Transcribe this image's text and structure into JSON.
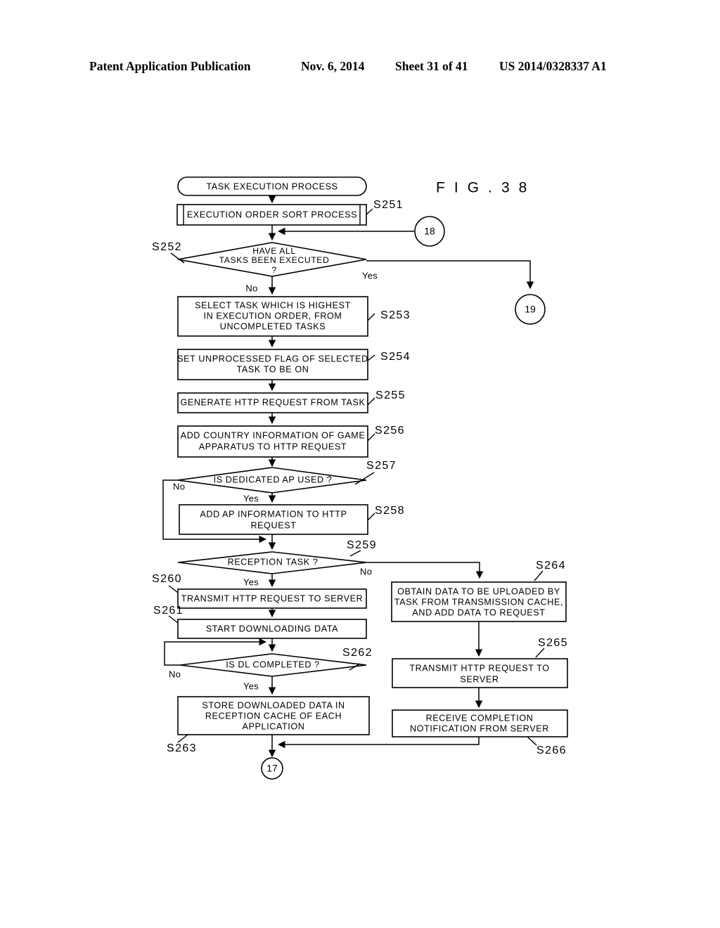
{
  "header": {
    "publication": "Patent Application Publication",
    "date": "Nov. 6, 2014",
    "sheet": "Sheet 31 of 41",
    "patent_number": "US 2014/0328337 A1"
  },
  "figure": {
    "title": "F I G .  3 8",
    "start_terminal": "TASK EXECUTION PROCESS",
    "nodes": [
      {
        "id": "S251",
        "label": "S251",
        "type": "predefined-process",
        "text": "EXECUTION ORDER SORT PROCESS"
      },
      {
        "id": "S252",
        "label": "S252",
        "type": "decision",
        "text": "HAVE ALL\nTASKS BEEN EXECUTED\n?"
      },
      {
        "id": "S253",
        "label": "S253",
        "type": "process",
        "text": "SELECT TASK WHICH IS HIGHEST\nIN EXECUTION ORDER, FROM\nUNCOMPLETED TASKS"
      },
      {
        "id": "S254",
        "label": "S254",
        "type": "process",
        "text": "SET UNPROCESSED FLAG OF SELECTED\nTASK TO BE ON"
      },
      {
        "id": "S255",
        "label": "S255",
        "type": "process",
        "text": "GENERATE HTTP REQUEST FROM TASK"
      },
      {
        "id": "S256",
        "label": "S256",
        "type": "process",
        "text": "ADD COUNTRY INFORMATION OF GAME\nAPPARATUS TO HTTP REQUEST"
      },
      {
        "id": "S257",
        "label": "S257",
        "type": "decision",
        "text": "IS DEDICATED AP USED ?"
      },
      {
        "id": "S258",
        "label": "S258",
        "type": "process",
        "text": "ADD AP INFORMATION TO HTTP\nREQUEST"
      },
      {
        "id": "S259",
        "label": "S259",
        "type": "decision",
        "text": "RECEPTION TASK ?"
      },
      {
        "id": "S260",
        "label": "S260",
        "type": "process",
        "text": "TRANSMIT HTTP REQUEST TO SERVER"
      },
      {
        "id": "S261",
        "label": "S261",
        "type": "process",
        "text": "START DOWNLOADING DATA"
      },
      {
        "id": "S262",
        "label": "S262",
        "type": "decision",
        "text": "IS DL COMPLETED ?"
      },
      {
        "id": "S263",
        "label": "S263",
        "type": "process",
        "text": "STORE DOWNLOADED DATA IN\nRECEPTION CACHE OF EACH\nAPPLICATION"
      },
      {
        "id": "S264",
        "label": "S264",
        "type": "process",
        "text": "OBTAIN DATA TO BE UPLOADED BY\nTASK FROM TRANSMISSION CACHE,\nAND ADD DATA TO REQUEST"
      },
      {
        "id": "S265",
        "label": "S265",
        "type": "process",
        "text": "TRANSMIT HTTP REQUEST TO\nSERVER"
      },
      {
        "id": "S266",
        "label": "S266",
        "type": "process",
        "text": "RECEIVE COMPLETION\nNOTIFICATION FROM SERVER"
      }
    ],
    "node_text": {
      "S251": "EXECUTION ORDER SORT PROCESS",
      "S252_line1": "HAVE ALL",
      "S252_line2": "TASKS BEEN EXECUTED",
      "S252_line3": "?",
      "S253_line1": "SELECT TASK WHICH IS HIGHEST",
      "S253_line2": "IN EXECUTION ORDER, FROM",
      "S253_line3": "UNCOMPLETED TASKS",
      "S254_line1": "SET UNPROCESSED FLAG OF SELECTED",
      "S254_line2": "TASK TO BE ON",
      "S255_line1": "GENERATE HTTP REQUEST FROM TASK",
      "S256_line1": "ADD COUNTRY INFORMATION OF GAME",
      "S256_line2": "APPARATUS TO HTTP REQUEST",
      "S257_line1": "IS DEDICATED AP USED ?",
      "S258_line1": "ADD AP INFORMATION TO HTTP",
      "S258_line2": "REQUEST",
      "S259_line1": "RECEPTION TASK ?",
      "S260_line1": "TRANSMIT HTTP REQUEST TO SERVER",
      "S261_line1": "START DOWNLOADING DATA",
      "S262_line1": "IS DL COMPLETED ?",
      "S263_line1": "STORE DOWNLOADED DATA IN",
      "S263_line2": "RECEPTION CACHE OF EACH",
      "S263_line3": "APPLICATION",
      "S264_line1": "OBTAIN DATA TO BE UPLOADED BY",
      "S264_line2": "TASK FROM TRANSMISSION CACHE,",
      "S264_line3": "AND ADD DATA TO REQUEST",
      "S265_line1": "TRANSMIT HTTP REQUEST TO",
      "S265_line2": "SERVER",
      "S266_line1": "RECEIVE COMPLETION",
      "S266_line2": "NOTIFICATION FROM SERVER"
    },
    "step_labels": {
      "S251": "S251",
      "S252": "S252",
      "S253": "S253",
      "S254": "S254",
      "S255": "S255",
      "S256": "S256",
      "S257": "S257",
      "S258": "S258",
      "S259": "S259",
      "S260": "S260",
      "S261": "S261",
      "S262": "S262",
      "S263": "S263",
      "S264": "S264",
      "S265": "S265",
      "S266": "S266"
    },
    "branch_labels": {
      "s252_yes": "Yes",
      "s252_no": "No",
      "s257_no": "No",
      "s257_yes": "Yes",
      "s259_no": "No",
      "s259_yes": "Yes",
      "s262_no": "No",
      "s262_yes": "Yes"
    },
    "connectors": {
      "in_18": "18",
      "out_19": "19",
      "out_17": "17"
    }
  }
}
